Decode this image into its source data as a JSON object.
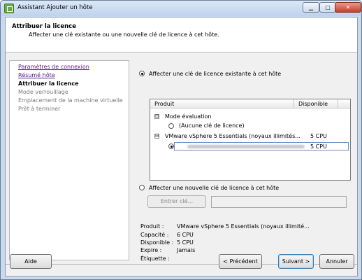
{
  "window": {
    "title": "Assistant Ajouter un hôte",
    "minimize_glyph": "▁",
    "maximize_glyph": "□",
    "close_glyph": "✕"
  },
  "header": {
    "title": "Attribuer la licence",
    "subtitle": "Affecter une clé existante ou une nouvelle clé de licence à cet hôte."
  },
  "nav": {
    "items": [
      {
        "label": "Paramètres de connexion",
        "state": "visited"
      },
      {
        "label": "Résumé hôte",
        "state": "visited"
      },
      {
        "label": "Attribuer la licence",
        "state": "current"
      },
      {
        "label": "Mode verrouillage",
        "state": "disabled"
      },
      {
        "label": "Emplacement de la machine virtuelle",
        "state": "disabled"
      },
      {
        "label": "Prêt à terminer",
        "state": "disabled"
      }
    ]
  },
  "license": {
    "existing_option": "Affecter une clé de licence existante à cet hôte",
    "existing_selected": true,
    "table": {
      "col_product": "Produit",
      "col_available": "Disponible",
      "groups": [
        {
          "expander": "⊟",
          "name": "Mode évaluation",
          "rows": [
            {
              "label": "(Aucune clé de licence)",
              "available": "",
              "selected": false
            }
          ]
        },
        {
          "expander": "⊟",
          "name": "VMware vSphere 5 Essentials (noyaux illimités...",
          "available": "5 CPU",
          "rows": [
            {
              "label": "",
              "available": "5 CPU",
              "selected": true
            }
          ]
        }
      ]
    },
    "new_option": "Affecter une nouvelle clé de licence à cet hôte",
    "new_selected": false,
    "enter_key_button": "Entrer clé...",
    "key_value": ""
  },
  "details": {
    "rows": [
      {
        "label": "Produit :",
        "value": "VMware vSphere 5 Essentials (noyaux illimité..."
      },
      {
        "label": "Capacité :",
        "value": "6 CPU"
      },
      {
        "label": "Disponible :",
        "value": "5 CPU"
      },
      {
        "label": "Expire :",
        "value": "Jamais"
      },
      {
        "label": "Étiquette :",
        "value": ""
      }
    ]
  },
  "footer": {
    "help": "Aide",
    "previous": "< Précédent",
    "next": "Suivant >",
    "cancel": "Annuler"
  }
}
